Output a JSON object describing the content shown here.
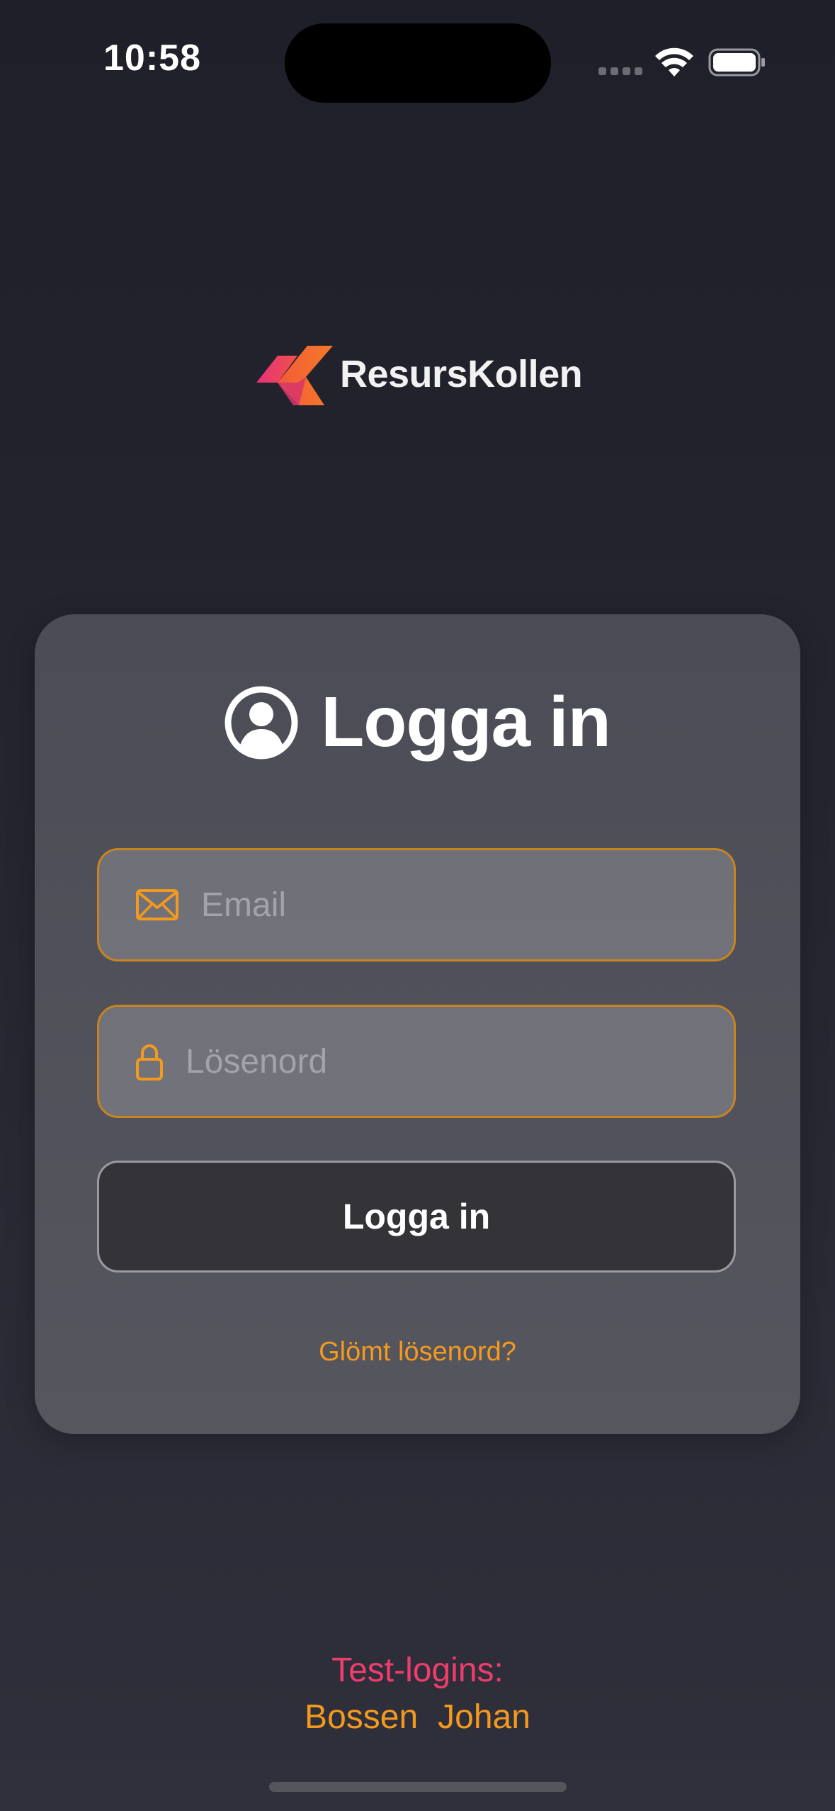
{
  "status_bar": {
    "time": "10:58"
  },
  "logo": {
    "text": "ResursKollen"
  },
  "login": {
    "title": "Logga in",
    "email_placeholder": "Email",
    "password_placeholder": "Lösenord",
    "email_value": "",
    "password_value": "",
    "submit_label": "Logga in",
    "forgot_label": "Glömt lösenord?"
  },
  "test_logins": {
    "label": "Test-logins:",
    "users": [
      "Bossen",
      "Johan"
    ]
  },
  "colors": {
    "accent": "#f39a1e",
    "field_border": "#c7841f",
    "test_label": "#ef3d6b",
    "background": "#262631",
    "card": "#50505a"
  },
  "icons": {
    "title": "user-circle-icon",
    "email": "mail-icon",
    "password": "lock-icon"
  }
}
